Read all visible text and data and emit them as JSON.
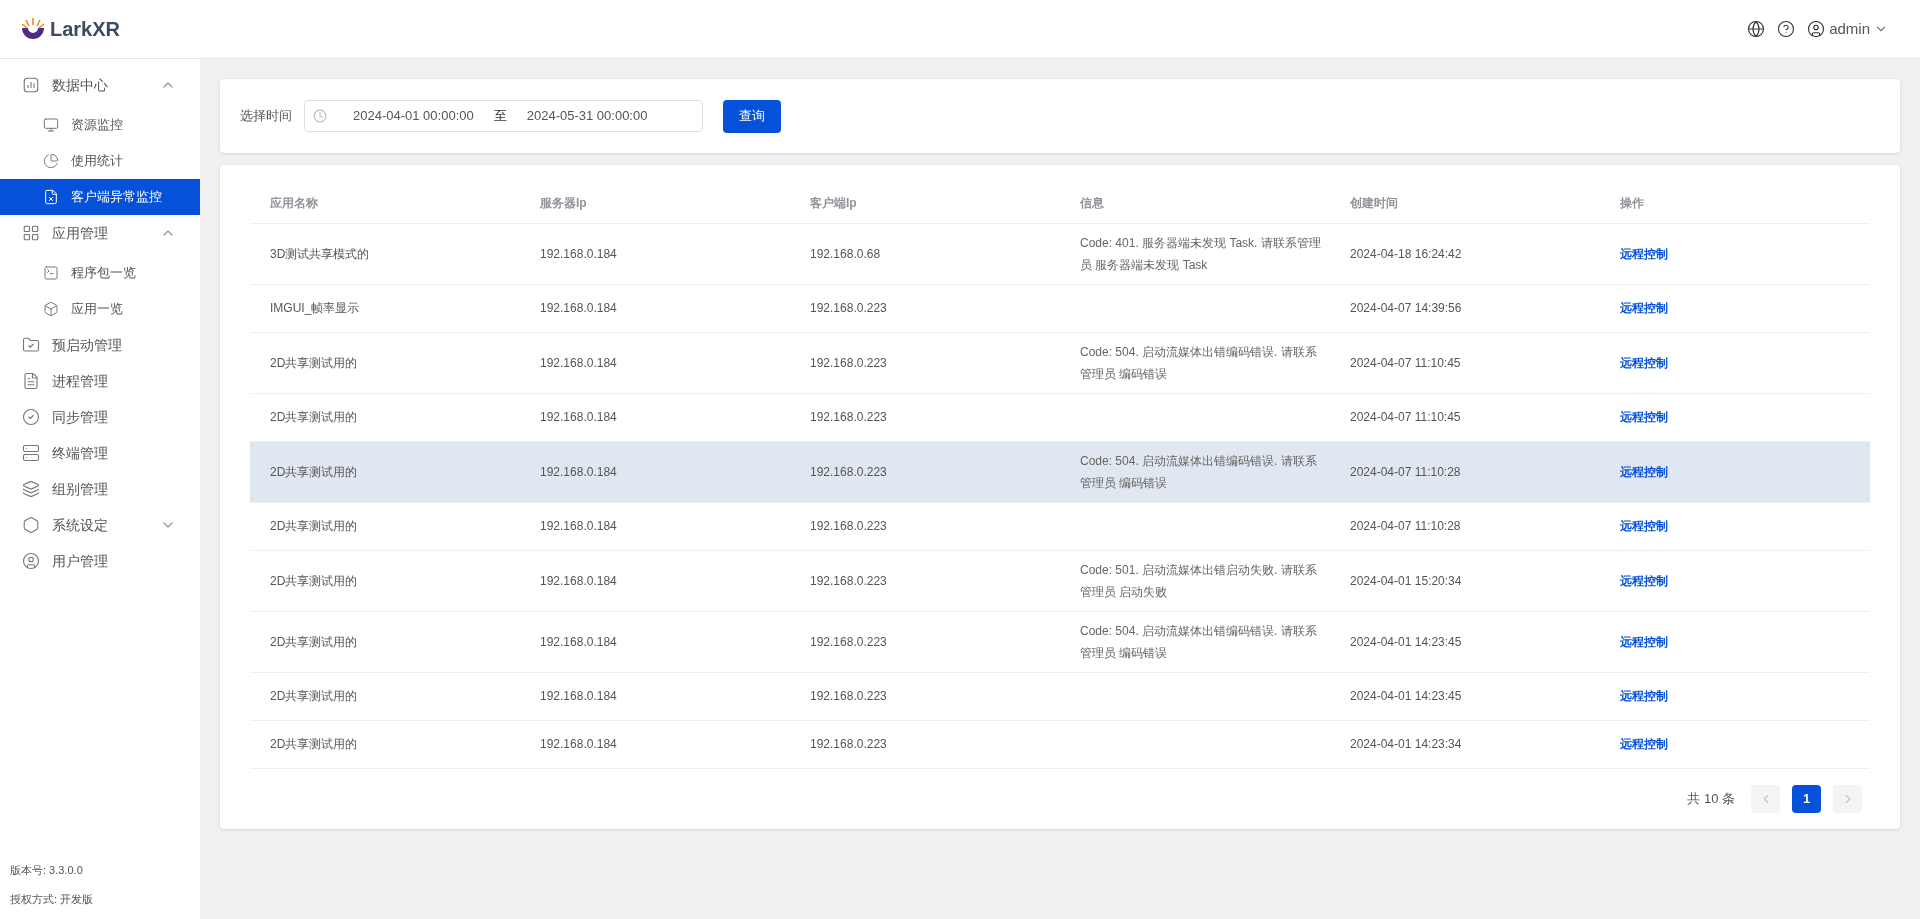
{
  "header": {
    "logo": "LarkXR",
    "user": "admin"
  },
  "sidebar": {
    "items": [
      {
        "label": "数据中心",
        "expanded": true,
        "selected": false,
        "children": [
          {
            "label": "资源监控",
            "selected": false
          },
          {
            "label": "使用统计",
            "selected": false
          },
          {
            "label": "客户端异常监控",
            "selected": true
          }
        ]
      },
      {
        "label": "应用管理",
        "expanded": true,
        "selected": false,
        "children": [
          {
            "label": "程序包一览",
            "selected": false
          },
          {
            "label": "应用一览",
            "selected": false
          }
        ]
      },
      {
        "label": "预启动管理",
        "selected": false
      },
      {
        "label": "进程管理",
        "selected": false
      },
      {
        "label": "同步管理",
        "selected": false
      },
      {
        "label": "终端管理",
        "selected": false
      },
      {
        "label": "组别管理",
        "selected": false
      },
      {
        "label": "系统设定",
        "expanded": false,
        "selected": false
      },
      {
        "label": "用户管理",
        "selected": false
      }
    ],
    "footer": [
      "版本号: 3.3.0.0",
      "授权方式: 开发版"
    ]
  },
  "filter": {
    "label": "选择时间",
    "start": "2024-04-01 00:00:00",
    "separator": "至",
    "end": "2024-05-31 00:00:00",
    "button": "查询"
  },
  "table": {
    "columns": [
      "应用名称",
      "服务器Ip",
      "客户端Ip",
      "信息",
      "创建时间",
      "操作"
    ],
    "rows": [
      {
        "app": "3D测试共享模式的",
        "server_ip": "192.168.0.184",
        "client_ip": "192.168.0.68",
        "info": "Code: 401. 服务器端未发现 Task. 请联系管理员 服务器端未发现 Task",
        "created": "2024-04-18 16:24:42",
        "action": "远程控制",
        "highlighted": false
      },
      {
        "app": "IMGUI_帧率显示",
        "server_ip": "192.168.0.184",
        "client_ip": "192.168.0.223",
        "info": "",
        "created": "2024-04-07 14:39:56",
        "action": "远程控制",
        "highlighted": false
      },
      {
        "app": "2D共享测试用的",
        "server_ip": "192.168.0.184",
        "client_ip": "192.168.0.223",
        "info": "Code: 504. 启动流媒体出错编码错误. 请联系管理员 编码错误",
        "created": "2024-04-07 11:10:45",
        "action": "远程控制",
        "highlighted": false
      },
      {
        "app": "2D共享测试用的",
        "server_ip": "192.168.0.184",
        "client_ip": "192.168.0.223",
        "info": "",
        "created": "2024-04-07 11:10:45",
        "action": "远程控制",
        "highlighted": false
      },
      {
        "app": "2D共享测试用的",
        "server_ip": "192.168.0.184",
        "client_ip": "192.168.0.223",
        "info": "Code: 504. 启动流媒体出错编码错误. 请联系管理员 编码错误",
        "created": "2024-04-07 11:10:28",
        "action": "远程控制",
        "highlighted": true
      },
      {
        "app": "2D共享测试用的",
        "server_ip": "192.168.0.184",
        "client_ip": "192.168.0.223",
        "info": "",
        "created": "2024-04-07 11:10:28",
        "action": "远程控制",
        "highlighted": false
      },
      {
        "app": "2D共享测试用的",
        "server_ip": "192.168.0.184",
        "client_ip": "192.168.0.223",
        "info": "Code: 501. 启动流媒体出错启动失败. 请联系管理员 启动失败",
        "created": "2024-04-01 15:20:34",
        "action": "远程控制",
        "highlighted": false
      },
      {
        "app": "2D共享测试用的",
        "server_ip": "192.168.0.184",
        "client_ip": "192.168.0.223",
        "info": "Code: 504. 启动流媒体出错编码错误. 请联系管理员 编码错误",
        "created": "2024-04-01 14:23:45",
        "action": "远程控制",
        "highlighted": false
      },
      {
        "app": "2D共享测试用的",
        "server_ip": "192.168.0.184",
        "client_ip": "192.168.0.223",
        "info": "",
        "created": "2024-04-01 14:23:45",
        "action": "远程控制",
        "highlighted": false
      },
      {
        "app": "2D共享测试用的",
        "server_ip": "192.168.0.184",
        "client_ip": "192.168.0.223",
        "info": "",
        "created": "2024-04-01 14:23:34",
        "action": "远程控制",
        "highlighted": false
      }
    ]
  },
  "pagination": {
    "total": "共 10 条",
    "prev_disabled": true,
    "next_disabled": true,
    "pages": [
      {
        "label": "1",
        "selected": true
      }
    ]
  }
}
